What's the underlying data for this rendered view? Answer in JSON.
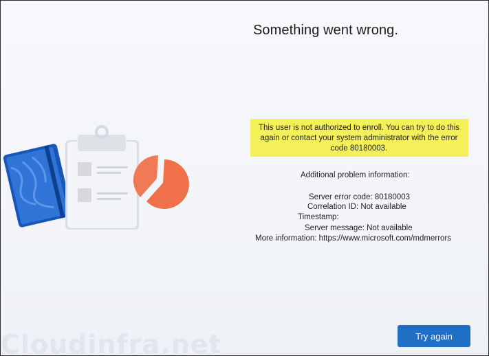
{
  "dialog": {
    "title": "Something went wrong.",
    "error_message": "This user is not authorized to enroll. You can try to do this again or contact your system administrator with the error code 80180003.",
    "highlight_color": "#f4f05a",
    "additional_info_heading": "Additional problem information:",
    "server_error_code": "Server error code: 80180003",
    "correlation_id": "Correlation ID: Not available",
    "timestamp": "Timestamp:",
    "server_message": "Server message: Not available",
    "more_information": "More information: https://www.microsoft.com/mdmerrors",
    "try_again_label": "Try again",
    "button_color": "#1f6fc5"
  },
  "illustration": {
    "icons": [
      "notebook-icon",
      "clipboard-icon",
      "pie-chart-icon"
    ]
  },
  "watermark": "Cloudinfra.net"
}
